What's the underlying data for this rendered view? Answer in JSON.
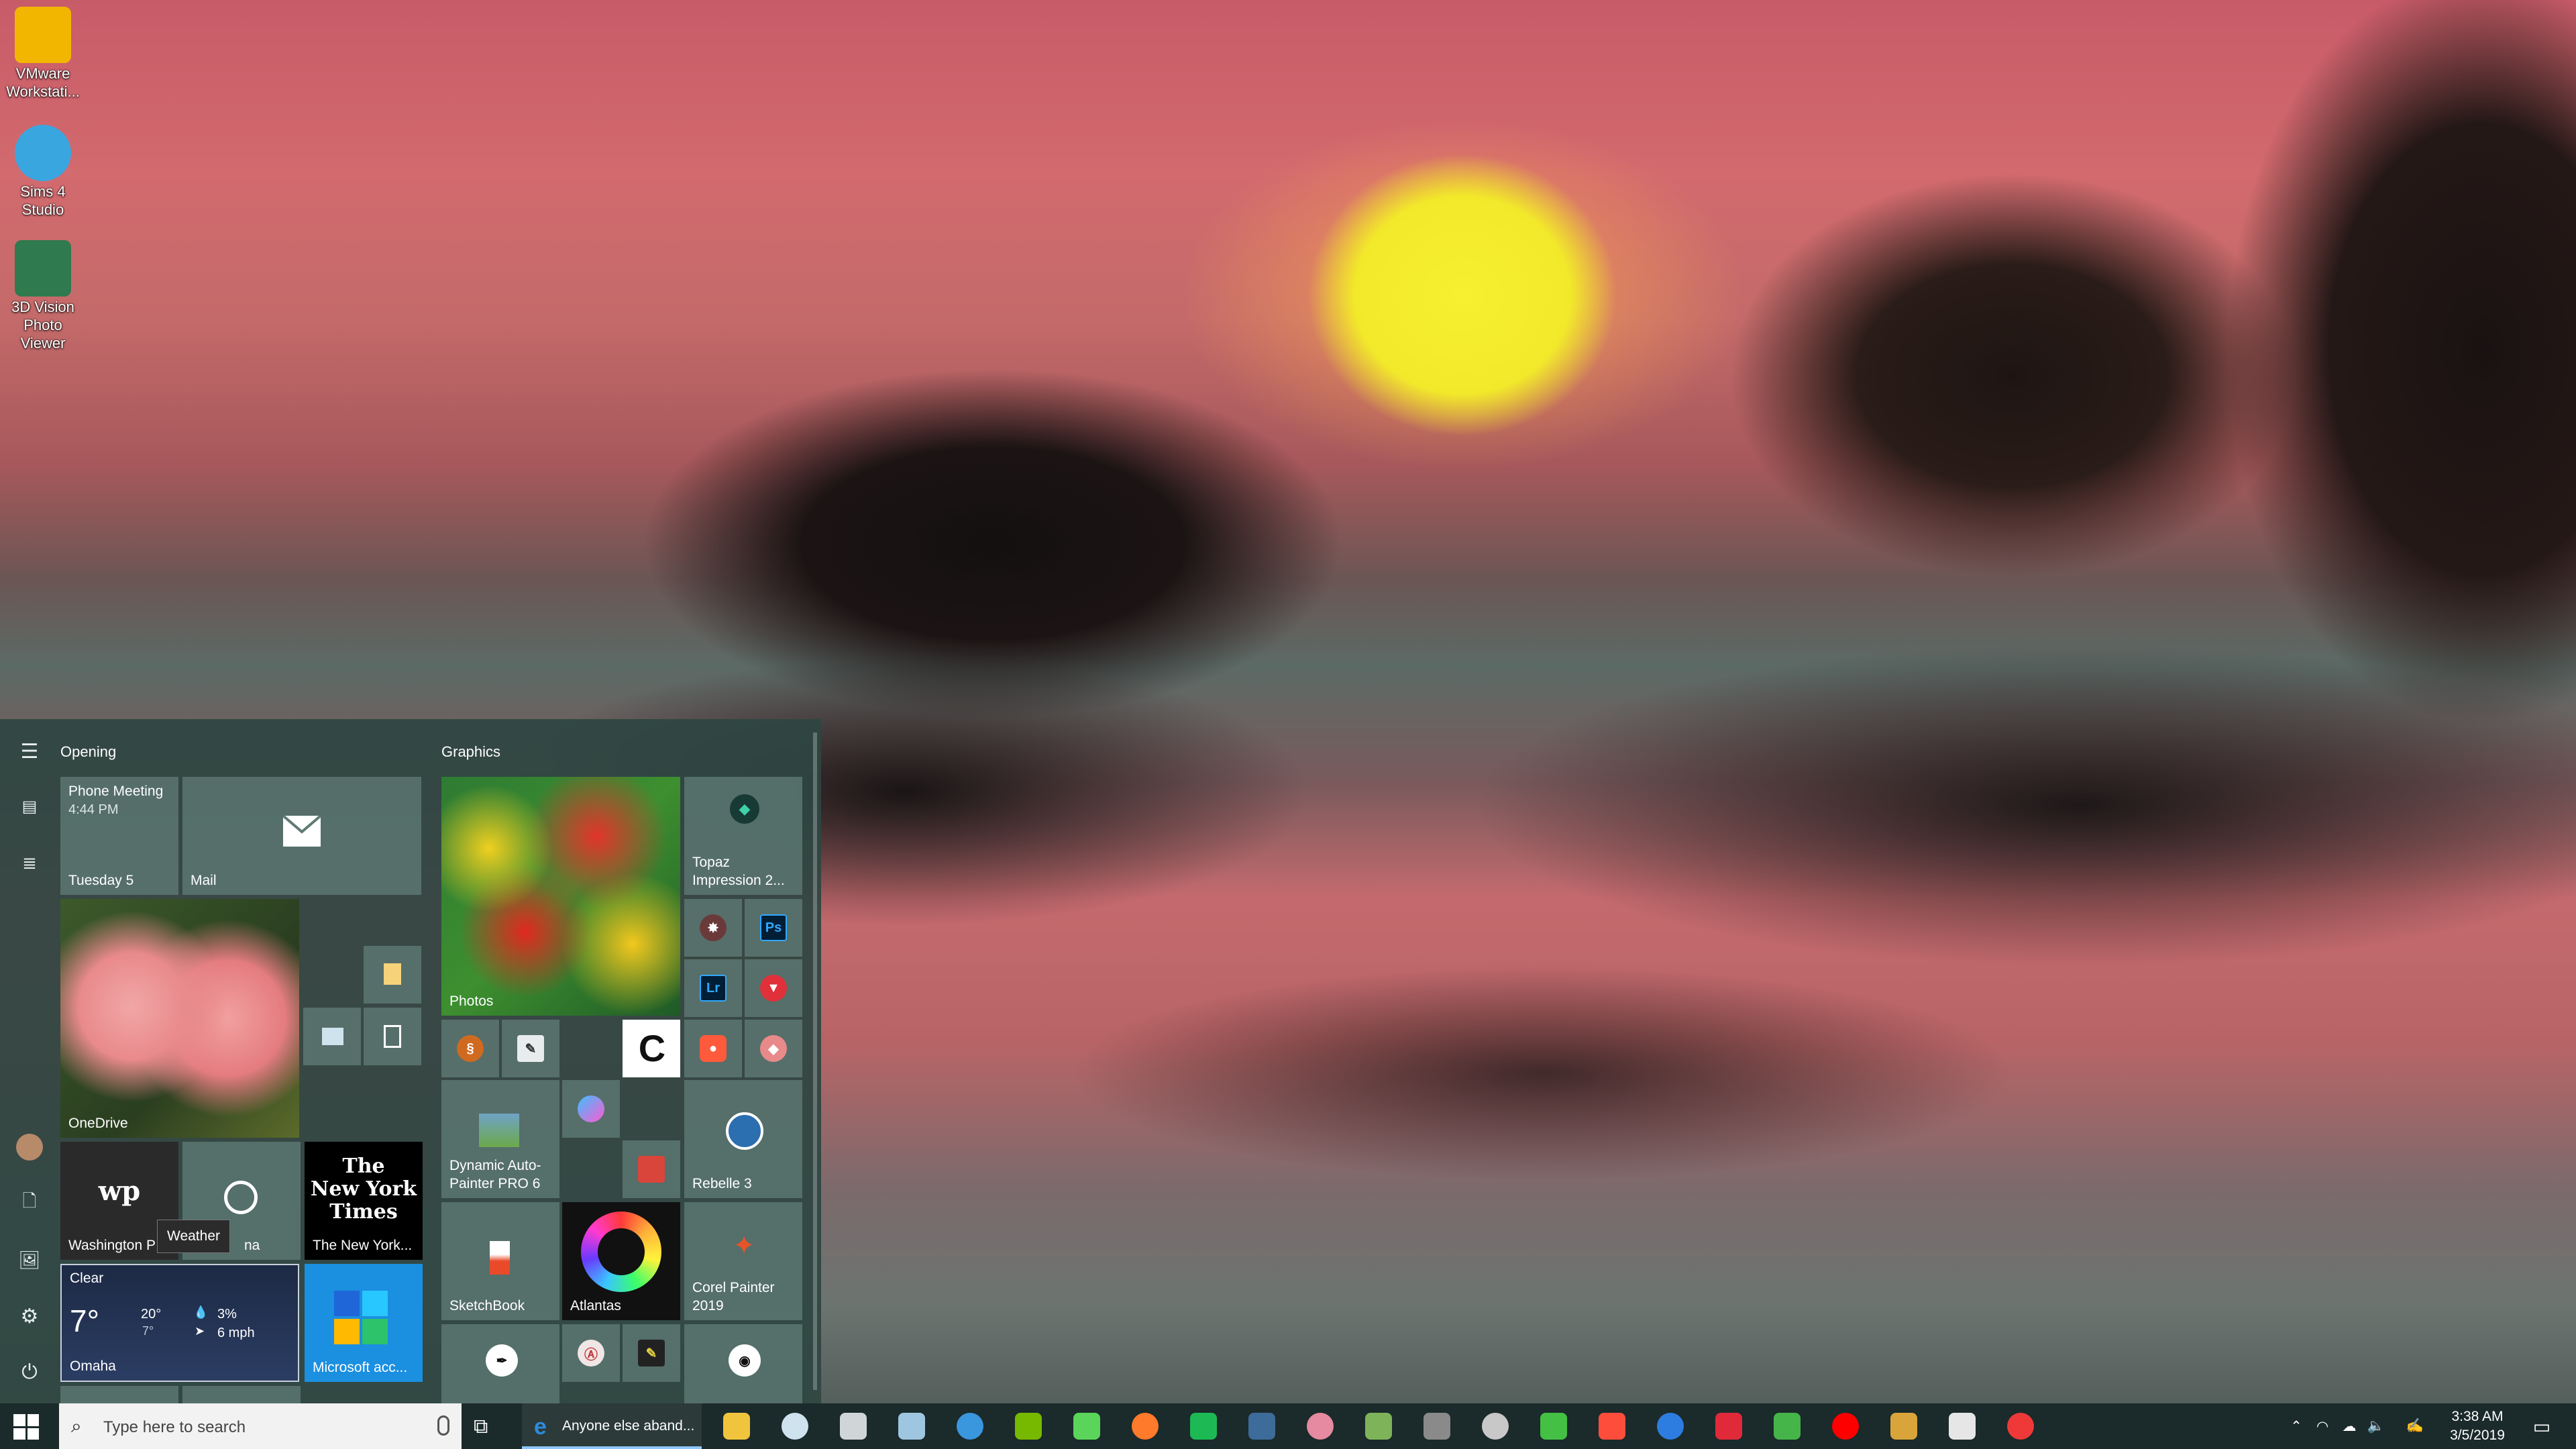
{
  "desktop": {
    "icons": [
      {
        "label_line1": "VMware",
        "label_line2": "Workstati...",
        "icon": "vmware-icon",
        "color": "#f2b600"
      },
      {
        "label_line1": "Sims 4 Studio",
        "label_line2": "",
        "icon": "sims4-studio-icon",
        "color": "#3aa6e0"
      },
      {
        "label_line1": "3D Vision",
        "label_line2": "Photo Viewer",
        "icon": "3d-vision-icon",
        "color": "#2f7a4e"
      }
    ]
  },
  "start_menu": {
    "groups": {
      "opening": "Opening",
      "graphics": "Graphics"
    },
    "tiles": {
      "calendar": {
        "title": "Phone Meeting",
        "time": "4:44 PM",
        "date": "Tuesday 5"
      },
      "mail": {
        "label": "Mail"
      },
      "onedrive": {
        "label": "OneDrive"
      },
      "washington_post": {
        "label": "Washington P",
        "logo": "wp"
      },
      "cortana": {
        "label": "na"
      },
      "nyt": {
        "line1": "The",
        "line2": "New York",
        "line3": "Times",
        "label": "The New York..."
      },
      "weather": {
        "condition": "Clear",
        "temp": "7°",
        "high": "20°",
        "low": "7°",
        "precip": "3%",
        "wind": "6 mph",
        "city": "Omaha"
      },
      "microsoft_account": {
        "label": "Microsoft acc..."
      },
      "photos": {
        "label": "Photos"
      },
      "topaz": {
        "label_line1": "Topaz",
        "label_line2": "Impression 2..."
      },
      "dynamic_auto_painter": {
        "label_line1": "Dynamic Auto-",
        "label_line2": "Painter PRO 6"
      },
      "rebelle": {
        "label": "Rebelle 3"
      },
      "sketchbook": {
        "label": "SketchBook"
      },
      "atlantas": {
        "label": "Atlantas"
      },
      "corel_painter": {
        "label_line1": "Corel Painter",
        "label_line2": "2019"
      },
      "photoshop_badge": "Ps",
      "lightroom_badge": "Lr",
      "celsys_badge": "C"
    },
    "tooltip": "Weather"
  },
  "taskbar": {
    "search_placeholder": "Type here to search",
    "active_window": "Anyone else aband...",
    "clock_time": "3:38 AM",
    "clock_date": "3/5/2019",
    "icons": [
      {
        "name": "file-explorer-icon",
        "color": "#f0c43c"
      },
      {
        "name": "notepad-icon",
        "color": "#cfe3ef"
      },
      {
        "name": "device-icon",
        "color": "#d0d6d8"
      },
      {
        "name": "brush-app-icon",
        "color": "#9fc6e0"
      },
      {
        "name": "visual-studio-icon",
        "color": "#3a96dd"
      },
      {
        "name": "nvidia-icon",
        "color": "#76b900"
      },
      {
        "name": "maps-pin-icon",
        "color": "#5ad45a"
      },
      {
        "name": "firefox-icon",
        "color": "#ff7a2a"
      },
      {
        "name": "spotify-icon",
        "color": "#1db954"
      },
      {
        "name": "steam-icon",
        "color": "#3d6c9a"
      },
      {
        "name": "paint-app-icon",
        "color": "#e58aa0"
      },
      {
        "name": "photos-app-icon",
        "color": "#7fb35a"
      },
      {
        "name": "stylus-icon",
        "color": "#8a8a8a"
      },
      {
        "name": "gamepad-icon",
        "color": "#c8c8c8"
      },
      {
        "name": "green-star-icon",
        "color": "#44c044"
      },
      {
        "name": "origami-icon",
        "color": "#ff4d3c"
      },
      {
        "name": "window-app-icon",
        "color": "#2d7de0"
      },
      {
        "name": "m-app-icon",
        "color": "#e02a3a"
      },
      {
        "name": "green-leaf-icon",
        "color": "#45b54a"
      },
      {
        "name": "youtube-icon",
        "color": "#ff0000"
      },
      {
        "name": "colorful-app-icon",
        "color": "#d9a43a"
      },
      {
        "name": "mega-m-icon",
        "color": "#e6e6e6"
      },
      {
        "name": "vivaldi-icon",
        "color": "#ef3939"
      }
    ]
  }
}
